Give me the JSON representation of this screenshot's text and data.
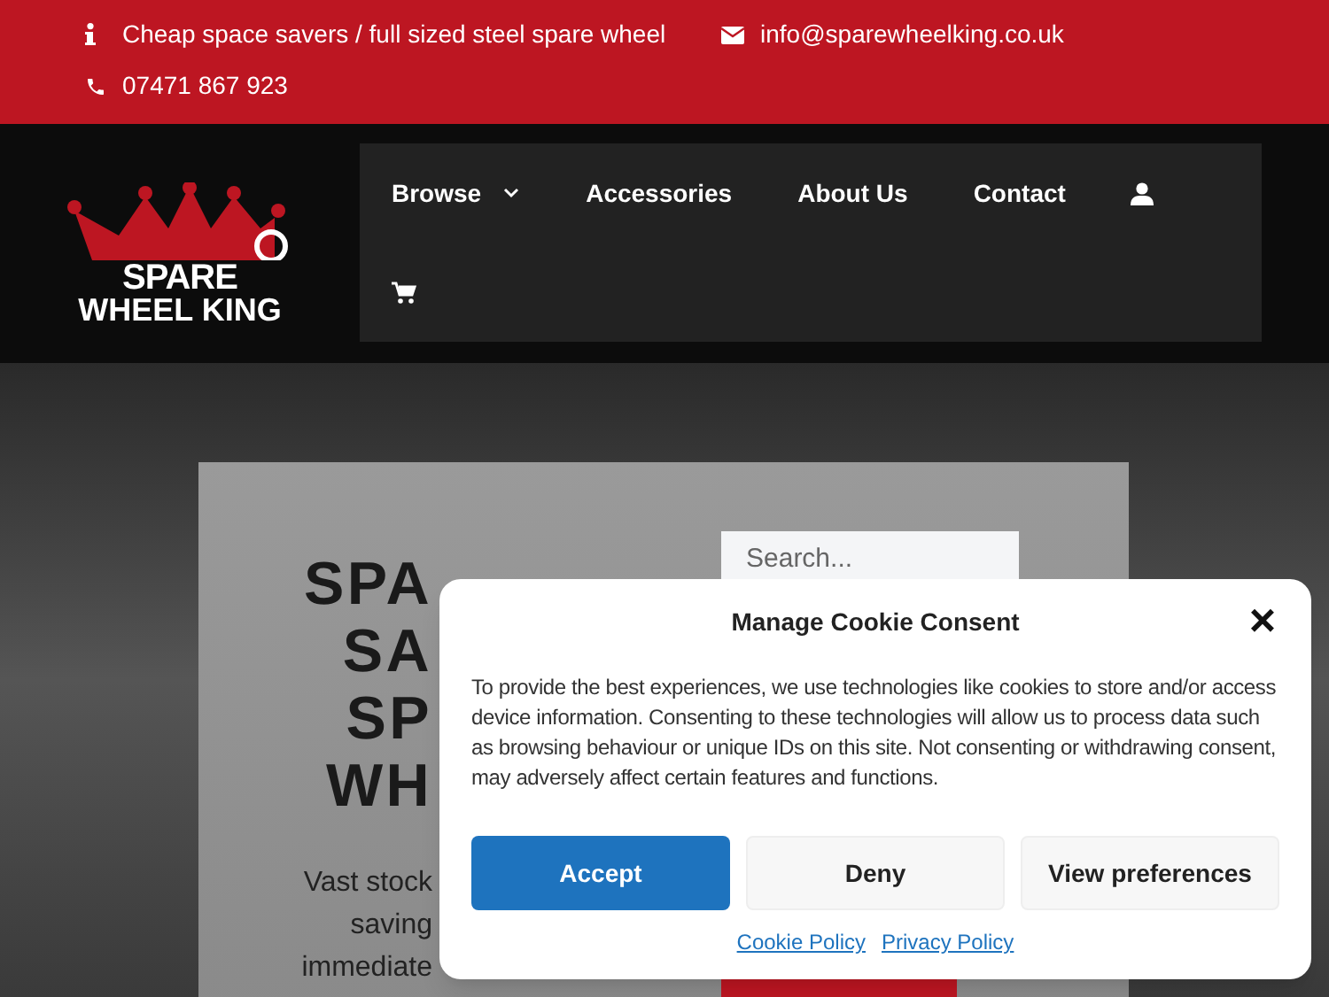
{
  "topbar": {
    "tagline": "Cheap space savers / full sized steel spare wheel",
    "email": "info@sparewheelking.co.uk",
    "phone": "07471 867 923"
  },
  "logo": {
    "line1": "SPARE",
    "line2": "WHEEL KING"
  },
  "nav": {
    "items": [
      {
        "label": "Browse",
        "kind": "dropdown"
      },
      {
        "label": "Accessories",
        "kind": "link"
      },
      {
        "label": "About Us",
        "kind": "link"
      },
      {
        "label": "Contact",
        "kind": "link"
      },
      {
        "kind": "account"
      },
      {
        "kind": "cart"
      }
    ]
  },
  "hero": {
    "title_lines": [
      "SPA",
      "SA",
      "SP",
      "WH"
    ],
    "text_lines": [
      "Vast stock",
      "saving",
      "immediate"
    ],
    "search": {
      "placeholder": "Search..."
    }
  },
  "cookie_dialog": {
    "title": "Manage Cookie Consent",
    "close": "×",
    "body": "To provide the best experiences, we use technologies like cookies to store and/or access device information. Consenting to these technologies will allow us to process data such as browsing behaviour or unique IDs on this site. Not consenting or withdrawing consent, may adversely affect certain features and functions.",
    "buttons": [
      {
        "label": "Accept",
        "kind": "primary"
      },
      {
        "label": "Deny",
        "kind": "secondary"
      },
      {
        "label": "View preferences",
        "kind": "secondary"
      }
    ],
    "links": [
      "Cookie Policy",
      "Privacy Policy"
    ]
  }
}
